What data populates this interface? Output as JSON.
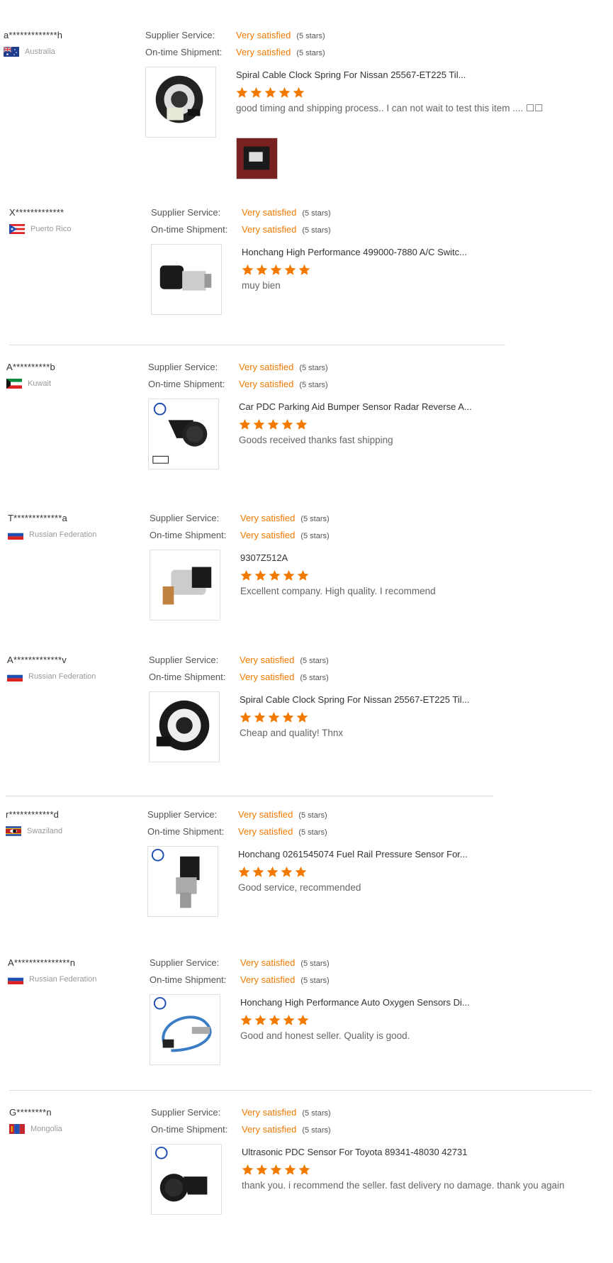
{
  "labels": {
    "supplier_service": "Supplier Service:",
    "ontime_shipment": "On-time Shipment:",
    "very_satisfied": "Very satisfied",
    "five_stars": "(5 stars)"
  },
  "colors": {
    "accent": "#f27a00",
    "divider": "#dddddd"
  },
  "reviews": [
    {
      "user": "a*************h",
      "country": "Australia",
      "flag": "australia-flag",
      "product": "Spiral Cable Clock Spring For Nissan 25567-ET225 Til...",
      "rating": 5,
      "comment": "good timing and shipping process.. I can not wait to test this item .... ☐☐",
      "image": "clock-spring-product-image"
    },
    {
      "user": "X*************",
      "country": "Puerto Rico",
      "flag": "puerto-rico-flag",
      "product": "Honchang High Performance 499000-7880 A/C Switc...",
      "rating": 5,
      "comment": "muy bien",
      "image": "pressure-switch-product-image"
    },
    {
      "user": "A**********b",
      "country": "Kuwait",
      "flag": "kuwait-flag",
      "product": "Car PDC Parking Aid Bumper Sensor Radar Reverse A...",
      "rating": 5,
      "comment": "Goods received thanks fast shipping",
      "image": "pdc-sensor-product-image"
    },
    {
      "user": "T*************a",
      "country": "Russian Federation",
      "flag": "russia-flag",
      "product": "9307Z512A",
      "rating": 5,
      "comment": "Excellent company. High quality. I recommend",
      "image": "pressure-sensor-product-image"
    },
    {
      "user": "A*************v",
      "country": "Russian Federation",
      "flag": "russia-flag",
      "product": "Spiral Cable Clock Spring For Nissan 25567-ET225 Til...",
      "rating": 5,
      "comment": "Cheap and quality! Thnx",
      "image": "clock-spring-product-image"
    },
    {
      "user": "r************d",
      "country": "Swaziland",
      "flag": "swaziland-flag",
      "product": "Honchang 0261545074 Fuel Rail Pressure Sensor For...",
      "rating": 5,
      "comment": "Good service, recommended",
      "image": "fuel-rail-sensor-product-image"
    },
    {
      "user": "A***************n",
      "country": "Russian Federation",
      "flag": "russia-flag",
      "product": "Honchang High Performance Auto Oxygen Sensors Di...",
      "rating": 5,
      "comment": "Good and honest seller. Quality is good.",
      "image": "oxygen-sensor-product-image"
    },
    {
      "user": "G********n",
      "country": "Mongolia",
      "flag": "mongolia-flag",
      "product": "Ultrasonic PDC Sensor For Toyota 89341-48030 42731",
      "rating": 5,
      "comment": "thank you. i recommend the seller. fast delivery no damage. thank you again",
      "image": "ultrasonic-sensor-product-image"
    }
  ]
}
